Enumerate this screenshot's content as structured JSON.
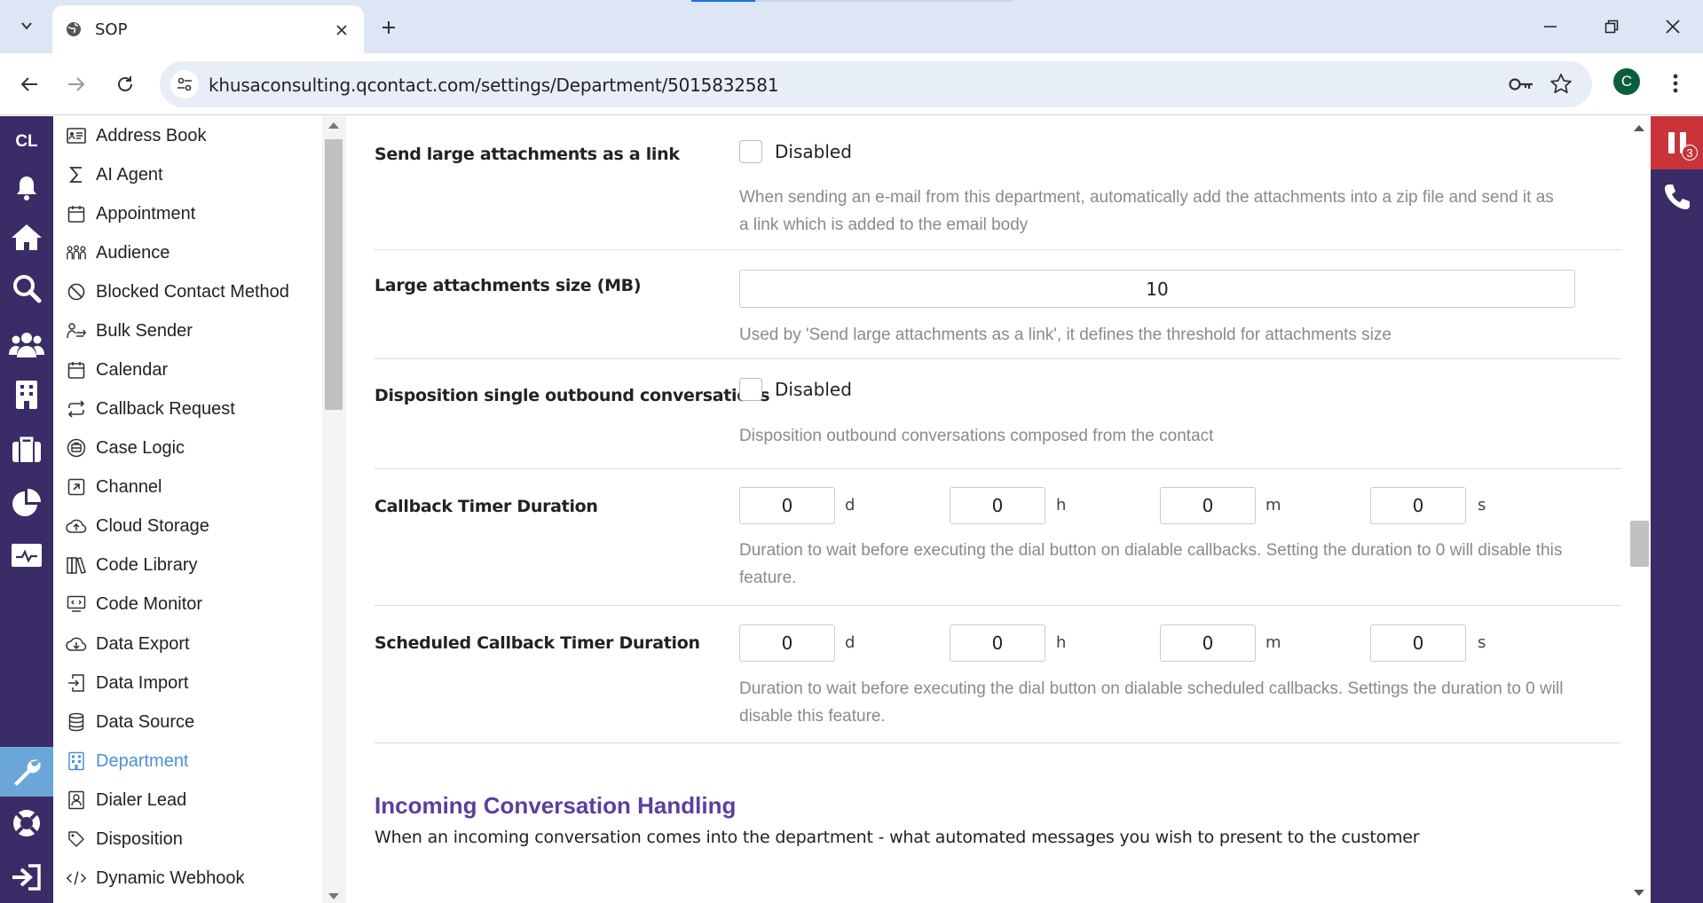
{
  "browser": {
    "tab_title": "SOP",
    "url": "khusaconsulting.qcontact.com/settings/Department/5015832581",
    "profile_initial": "C"
  },
  "rail": {
    "logo": "CL",
    "icons": [
      "bell-icon",
      "home-icon",
      "search-icon",
      "users-icon",
      "building-icon",
      "briefcase-icon",
      "pie-chart-icon",
      "monitor-chart-icon",
      "wrench-icon",
      "lifebuoy-icon",
      "logout-icon"
    ]
  },
  "right_rail": {
    "badge_count": "3"
  },
  "settings_menu": {
    "items": [
      {
        "label": "Address Book",
        "icon": "address-book-icon"
      },
      {
        "label": "AI Agent",
        "icon": "sigma-icon"
      },
      {
        "label": "Appointment",
        "icon": "calendar-icon"
      },
      {
        "label": "Audience",
        "icon": "audience-icon"
      },
      {
        "label": "Blocked Contact Method",
        "icon": "blocked-icon"
      },
      {
        "label": "Bulk Sender",
        "icon": "bulk-sender-icon"
      },
      {
        "label": "Calendar",
        "icon": "calendar-icon"
      },
      {
        "label": "Callback Request",
        "icon": "callback-icon"
      },
      {
        "label": "Case Logic",
        "icon": "case-logic-icon"
      },
      {
        "label": "Channel",
        "icon": "channel-icon"
      },
      {
        "label": "Cloud Storage",
        "icon": "cloud-upload-icon"
      },
      {
        "label": "Code Library",
        "icon": "books-icon"
      },
      {
        "label": "Code Monitor",
        "icon": "code-monitor-icon"
      },
      {
        "label": "Data Export",
        "icon": "cloud-download-icon"
      },
      {
        "label": "Data Import",
        "icon": "import-icon"
      },
      {
        "label": "Data Source",
        "icon": "database-icon"
      },
      {
        "label": "Department",
        "icon": "building-grid-icon",
        "active": true
      },
      {
        "label": "Dialer Lead",
        "icon": "contact-card-icon"
      },
      {
        "label": "Disposition",
        "icon": "tag-icon"
      },
      {
        "label": "Dynamic Webhook",
        "icon": "code-icon"
      }
    ]
  },
  "form": {
    "send_large_attachments": {
      "label": "Send large attachments as a link",
      "state": "Disabled",
      "help": "When sending an e-mail from this department, automatically add the attachments into a zip file and send it as a link which is added to the email body"
    },
    "large_attachments_size": {
      "label": "Large attachments size (MB)",
      "value": "10",
      "help": "Used by 'Send large attachments as a link', it defines the threshold for attachments size"
    },
    "disposition_single_outbound": {
      "label": "Disposition single outbound conversations",
      "state": "Disabled",
      "help": "Disposition outbound conversations composed from the contact"
    },
    "callback_timer": {
      "label": "Callback Timer Duration",
      "d": "0",
      "h": "0",
      "m": "0",
      "s": "0",
      "help": "Duration to wait before executing the dial button on dialable callbacks. Setting the duration to 0 will disable this feature."
    },
    "scheduled_callback_timer": {
      "label": "Scheduled Callback Timer Duration",
      "d": "0",
      "h": "0",
      "m": "0",
      "s": "0",
      "help": "Duration to wait before executing the dial button on dialable scheduled callbacks. Settings the duration to 0 will disable this feature."
    },
    "units": {
      "d": "d",
      "h": "h",
      "m": "m",
      "s": "s"
    }
  },
  "section": {
    "title": "Incoming Conversation Handling",
    "description": "When an incoming conversation comes into the department - what automated messages you wish to present to the customer"
  },
  "colors": {
    "rail": "#3a2c66",
    "active_rail": "#6aa7d8",
    "section_title": "#5a3f9f",
    "active_menu": "#4a90d9",
    "alert": "#c8343a"
  }
}
